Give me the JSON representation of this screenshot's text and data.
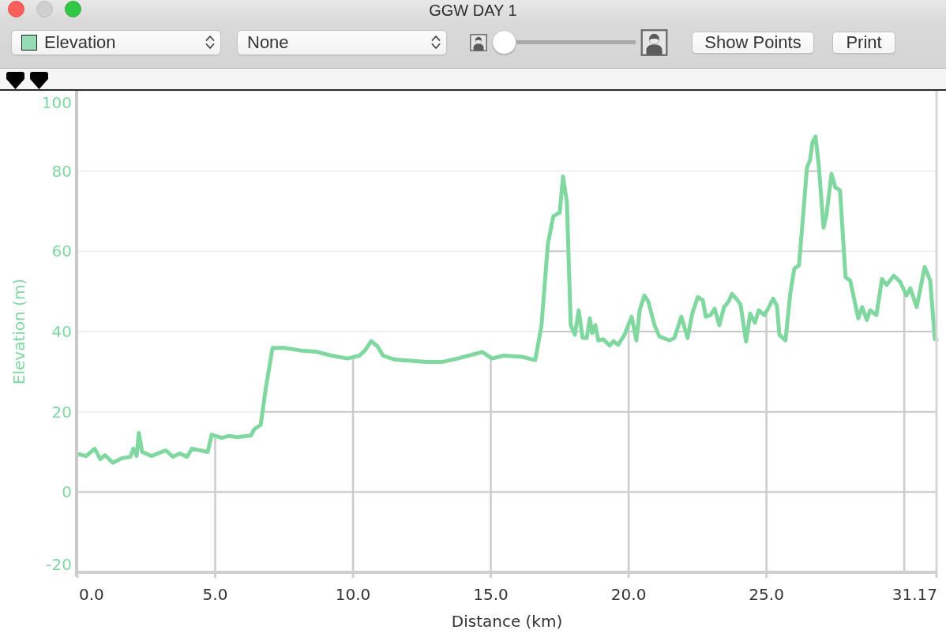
{
  "window": {
    "title": "GGW DAY 1",
    "controls": [
      {
        "kind": "close",
        "enabled": true
      },
      {
        "kind": "minimize",
        "enabled": false
      },
      {
        "kind": "zoom",
        "enabled": true
      }
    ]
  },
  "toolbar": {
    "popups": [
      {
        "label": "Elevation",
        "color": "#94dcb2"
      },
      {
        "label": "None"
      }
    ],
    "slider": {
      "level": 0
    },
    "buttons": [
      "Show Points",
      "Print"
    ]
  },
  "chart": {
    "chart_data": {
      "type": "line",
      "xlabel": "Distance (km)",
      "ylabel": "Elevation (m)",
      "grid": true,
      "x": [
        0,
        0.32,
        0.63,
        0.83,
        1.0,
        1.29,
        1.6,
        1.92,
        2.03,
        2.15,
        2.23,
        2.35,
        2.69,
        3.21,
        3.47,
        3.72,
        3.98,
        4.15,
        4.73,
        4.87,
        5.24,
        5.5,
        5.79,
        6.3,
        6.42,
        6.65,
        6.85,
        7.08,
        7.51,
        8.08,
        8.65,
        9.22,
        9.8,
        10.23,
        10.43,
        10.66,
        10.89,
        11.09,
        11.52,
        12.09,
        12.66,
        13.23,
        13.8,
        14.24,
        14.69,
        15.04,
        15.47,
        16.13,
        16.61,
        16.84,
        17.07,
        17.27,
        17.5,
        17.62,
        17.76,
        17.9,
        18.05,
        18.19,
        18.33,
        18.48,
        18.59,
        18.68,
        18.79,
        18.9,
        19.08,
        19.31,
        19.45,
        19.62,
        19.85,
        20.02,
        20.11,
        20.28,
        20.4,
        20.57,
        20.71,
        20.94,
        21.11,
        21.48,
        21.66,
        21.91,
        22.14,
        22.31,
        22.51,
        22.69,
        22.8,
        22.97,
        23.12,
        23.29,
        23.46,
        23.63,
        23.75,
        23.95,
        24.06,
        24.26,
        24.41,
        24.58,
        24.72,
        24.92,
        25.06,
        25.24,
        25.38,
        25.47,
        25.69,
        25.87,
        26.01,
        26.18,
        26.35,
        26.47,
        26.58,
        26.67,
        26.78,
        26.9,
        27.07,
        27.18,
        27.36,
        27.5,
        27.67,
        27.87,
        28.04,
        28.33,
        28.47,
        28.64,
        28.76,
        28.99,
        29.19,
        29.36,
        29.62,
        29.85,
        30.08,
        30.22,
        30.45,
        30.74,
        30.94,
        31.11,
        31.17
      ],
      "series": [
        {
          "color": "#80d8a0",
          "values": [
            9.5,
            9.0,
            10.8,
            8.2,
            9.2,
            7.3,
            8.4,
            8.8,
            10.8,
            9.0,
            14.7,
            10.0,
            9.0,
            10.4,
            8.8,
            9.6,
            8.8,
            10.8,
            10.0,
            14.3,
            13.5,
            14.0,
            13.7,
            14.1,
            15.7,
            16.7,
            26.5,
            35.9,
            35.9,
            35.3,
            35.0,
            34.0,
            33.3,
            34.0,
            35.3,
            37.6,
            36.3,
            34.0,
            33.0,
            32.7,
            32.4,
            32.4,
            33.3,
            34.1,
            34.9,
            33.3,
            34.0,
            33.7,
            32.9,
            41.6,
            61.8,
            68.8,
            69.6,
            78.6,
            72.2,
            41.6,
            39.2,
            45.3,
            38.4,
            38.4,
            43.3,
            39.6,
            41.6,
            37.8,
            38.1,
            36.5,
            37.6,
            36.7,
            39.2,
            42.2,
            43.7,
            37.8,
            45.3,
            49.0,
            47.5,
            41.6,
            38.8,
            37.8,
            38.4,
            43.7,
            38.4,
            44.5,
            48.6,
            47.8,
            43.7,
            44.1,
            45.7,
            41.6,
            46.1,
            47.5,
            49.4,
            47.8,
            46.7,
            37.5,
            44.5,
            42.2,
            45.3,
            44.1,
            45.7,
            48.2,
            46.4,
            39.2,
            37.8,
            49.8,
            55.7,
            56.5,
            70.7,
            80.8,
            82.7,
            87.2,
            88.6,
            81.2,
            65.9,
            69.2,
            79.3,
            75.9,
            75.2,
            53.5,
            52.7,
            43.3,
            46.1,
            42.9,
            45.3,
            44.1,
            53.1,
            51.6,
            53.9,
            52.4,
            49.0,
            50.8,
            46.1,
            56.1,
            52.7,
            38.1,
            38.0
          ]
        }
      ],
      "xlim": [
        0,
        31.17
      ],
      "ylim": [
        -20,
        100
      ],
      "xticks": [
        {
          "value": 0,
          "label": "0.0"
        },
        {
          "value": 5,
          "label": "5.0"
        },
        {
          "value": 10,
          "label": "10.0"
        },
        {
          "value": 15,
          "label": "15.0"
        },
        {
          "value": 20,
          "label": "20.0"
        },
        {
          "value": 25,
          "label": "25.0"
        },
        {
          "value": 31.17,
          "label": "31.17"
        }
      ],
      "yticks": [
        -20,
        0,
        20,
        40,
        60,
        80,
        100
      ]
    }
  }
}
